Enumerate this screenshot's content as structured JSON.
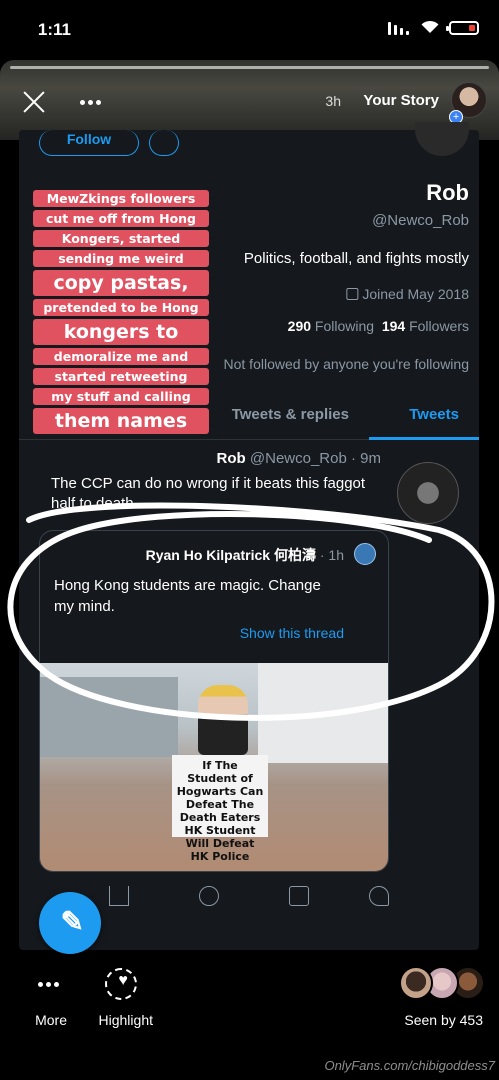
{
  "status_bar": {
    "time": "1:11"
  },
  "story": {
    "owner": "Your Story",
    "time_ago": "3h"
  },
  "profile": {
    "follow_label": "Follow",
    "name": "Rob",
    "handle": "@Newco_Rob",
    "bio": "Politics, football, and fights mostly",
    "joined": "Joined May 2018",
    "following_count": "290",
    "following_label": "Following",
    "followers_count": "194",
    "followers_label": "Followers",
    "not_followed": "Not followed by anyone you're following"
  },
  "tabs": [
    {
      "label": "Tweets",
      "active": true
    },
    {
      "label": "Tweets & replies",
      "active": false
    }
  ],
  "tweet": {
    "name": "Rob",
    "meta": "@Newco_Rob · 9m",
    "text": "The CCP can do no wrong if it beats this faggot half to death",
    "quote": {
      "name": "Ryan Ho Kilpatrick 何柏濤",
      "time": "1h",
      "text": "Hong Kong students are magic. Change my mind.",
      "show_thread": "Show this thread",
      "sign_text": "If The Student of Hogwarts Can Defeat The Death Eaters HK Student Will Defeat HK Police"
    }
  },
  "caption_lines": [
    {
      "text": "MewZkings followers",
      "big": false
    },
    {
      "text": "cut me off from Hong",
      "big": false
    },
    {
      "text": "Kongers, started",
      "big": false
    },
    {
      "text": "sending me weird",
      "big": false
    },
    {
      "text": "copy pastas,",
      "big": true
    },
    {
      "text": "pretended to be Hong",
      "big": false
    },
    {
      "text": "kongers to",
      "big": true
    },
    {
      "text": "demoralize me and",
      "big": false
    },
    {
      "text": "started retweeting",
      "big": false
    },
    {
      "text": "my stuff and calling",
      "big": false
    },
    {
      "text": "them names",
      "big": true
    }
  ],
  "bottom_bar": {
    "seen_by": "Seen by 453",
    "highlight": "Highlight",
    "more": "More"
  },
  "watermark": "OnlyFans.com/chibigoddess7",
  "colors": {
    "twitter_blue": "#1d9bf0",
    "caption_red": "#e05260"
  }
}
